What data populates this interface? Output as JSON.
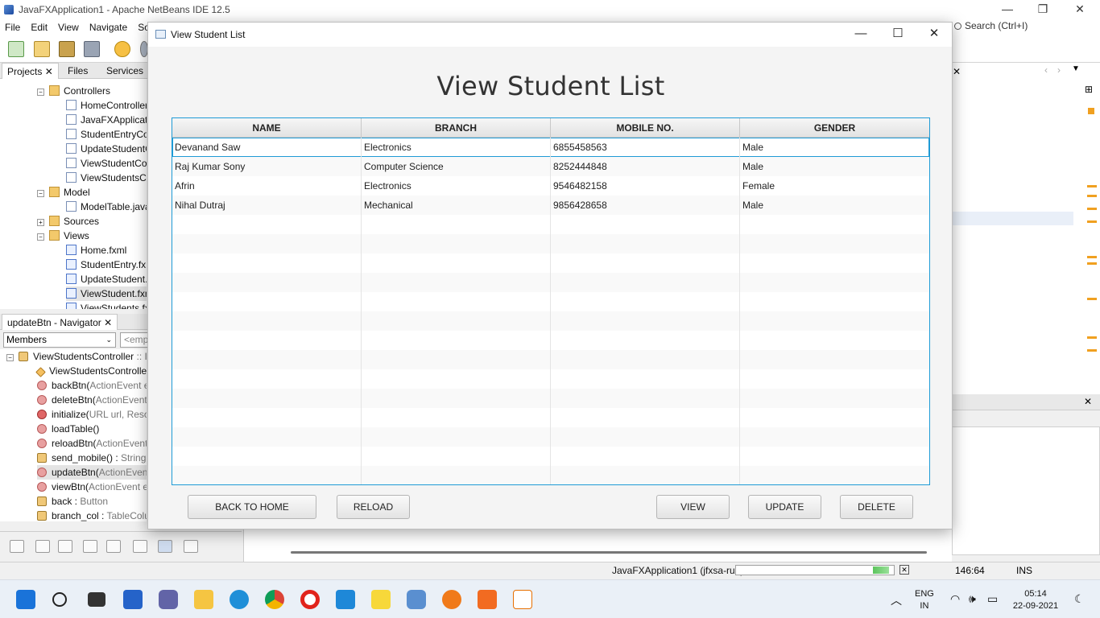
{
  "ide": {
    "title": "JavaFXApplication1 - Apache NetBeans IDE 12.5",
    "menu": [
      "File",
      "Edit",
      "View",
      "Navigate",
      "Sou"
    ],
    "search_placeholder": "Search (Ctrl+I)",
    "tabs": [
      "Projects",
      "Files",
      "Services"
    ],
    "tree": [
      {
        "label": "Controllers",
        "type": "package",
        "depth": 1,
        "expander": "−"
      },
      {
        "label": "HomeController.j",
        "type": "java",
        "depth": 2
      },
      {
        "label": "JavaFXApplicatio",
        "type": "java",
        "depth": 2
      },
      {
        "label": "StudentEntryCon",
        "type": "java",
        "depth": 2
      },
      {
        "label": "UpdateStudentC",
        "type": "java",
        "depth": 2
      },
      {
        "label": "ViewStudentCon",
        "type": "java",
        "depth": 2
      },
      {
        "label": "ViewStudentsCo",
        "type": "java",
        "depth": 2
      },
      {
        "label": "Model",
        "type": "package",
        "depth": 1,
        "expander": "−"
      },
      {
        "label": "ModelTable.java",
        "type": "java",
        "depth": 2
      },
      {
        "label": "Sources",
        "type": "package",
        "depth": 1,
        "expander": "+"
      },
      {
        "label": "Views",
        "type": "package",
        "depth": 1,
        "expander": "−"
      },
      {
        "label": "Home.fxml",
        "type": "fxml",
        "depth": 2
      },
      {
        "label": "StudentEntry.fx",
        "type": "fxml",
        "depth": 2
      },
      {
        "label": "UpdateStudent.",
        "type": "fxml",
        "depth": 2
      },
      {
        "label": "ViewStudent.fxm",
        "type": "fxml",
        "depth": 2,
        "selected": true
      },
      {
        "label": "ViewStudents.fx",
        "type": "fxml",
        "depth": 2
      }
    ],
    "navigator": {
      "tab_label": "updateBtn - Navigator",
      "filter": "Members",
      "empty": "<empt",
      "root": "ViewStudentsController",
      "root_suffix": " :: In",
      "members": [
        {
          "name": "ViewStudentsController(",
          "suffix": "",
          "kind": "ctor"
        },
        {
          "name": "backBtn(",
          "suffix": "ActionEvent ev",
          "kind": "method"
        },
        {
          "name": "deleteBtn(",
          "suffix": "ActionEvent e",
          "kind": "method"
        },
        {
          "name": "initialize(",
          "suffix": "URL url, Resour",
          "kind": "private"
        },
        {
          "name": "loadTable()",
          "suffix": "",
          "kind": "method"
        },
        {
          "name": "reloadBtn(",
          "suffix": "ActionEvent e",
          "kind": "method"
        },
        {
          "name": "send_mobile() : ",
          "suffix": "String",
          "kind": "field"
        },
        {
          "name": "updateBtn(",
          "suffix": "ActionEvent e",
          "kind": "method",
          "selected": true
        },
        {
          "name": "viewBtn(",
          "suffix": "ActionEvent ev",
          "kind": "method"
        },
        {
          "name": "back : ",
          "suffix": "Button",
          "kind": "field"
        },
        {
          "name": "branch_col : ",
          "suffix": "TableColum",
          "kind": "field"
        }
      ]
    },
    "status": {
      "run_label": "JavaFXApplication1 (jfxsa-run)",
      "cursor": "146:64",
      "mode": "INS",
      "progress": 0.1
    }
  },
  "dialog": {
    "title": "View Student List",
    "heading": "View Student List",
    "table": {
      "columns": [
        "NAME",
        "BRANCH",
        "MOBILE NO.",
        "GENDER"
      ],
      "rows": [
        [
          "Devanand Saw",
          "Electronics",
          "6855458563",
          "Male"
        ],
        [
          "Raj Kumar Sony",
          "Computer Science",
          "8252444848",
          "Male"
        ],
        [
          "Afrin",
          "Electronics",
          "9546482158",
          "Female"
        ],
        [
          "Nihal Dutraj",
          "Mechanical",
          "9856428658",
          "Male"
        ]
      ],
      "selected_row": 0,
      "empty_rows": 14
    },
    "buttons": {
      "back": "BACK TO HOME",
      "reload": "RELOAD",
      "view": "VIEW",
      "update": "UPDATE",
      "delete": "DELETE"
    }
  },
  "taskbar": {
    "lang_line1": "ENG",
    "lang_line2": "IN",
    "time": "05:14",
    "date": "22-09-2021"
  },
  "colors": {
    "table_focus": "#1f9bd6",
    "progress_fill": "#5cc45c"
  }
}
